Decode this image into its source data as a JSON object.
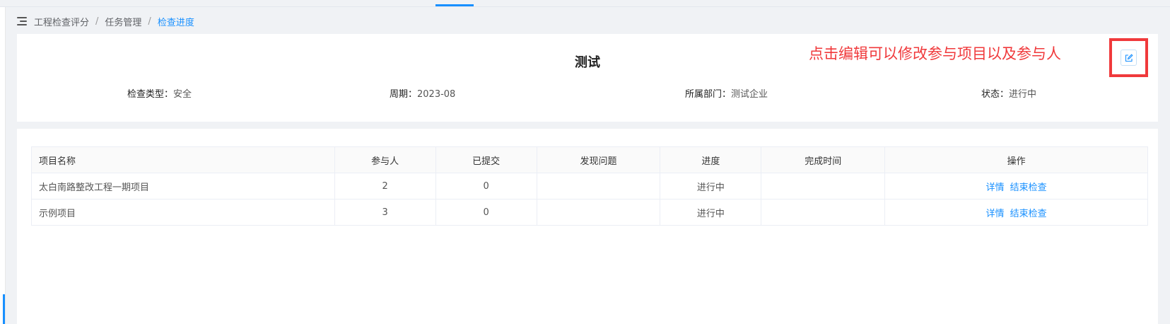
{
  "breadcrumb": {
    "items": [
      "工程检查评分",
      "任务管理"
    ],
    "current": "检查进度",
    "separator": "/"
  },
  "info": {
    "title": "测试",
    "fields": [
      {
        "label": "检查类型：",
        "value": "安全"
      },
      {
        "label": "周期：",
        "value": "2023-08"
      },
      {
        "label": "所属部门：",
        "value": "测试企业"
      },
      {
        "label": "状态：",
        "value": "进行中"
      }
    ],
    "annotation": "点击编辑可以修改参与项目以及参与人",
    "edit_icon": "edit-icon"
  },
  "table": {
    "headers": [
      "项目名称",
      "参与人",
      "已提交",
      "发现问题",
      "进度",
      "完成时间",
      "操作"
    ],
    "rows": [
      {
        "name": "太白南路整改工程一期项目",
        "participants": "2",
        "submitted": "0",
        "issues": "",
        "progress": "进行中",
        "finish_time": "",
        "actions": [
          "详情",
          "结束检查"
        ]
      },
      {
        "name": "示例项目",
        "participants": "3",
        "submitted": "0",
        "issues": "",
        "progress": "进行中",
        "finish_time": "",
        "actions": [
          "详情",
          "结束检查"
        ]
      }
    ]
  },
  "colors": {
    "accent": "#1890ff",
    "annotation": "#f0393b",
    "background": "#f0f2f5"
  }
}
